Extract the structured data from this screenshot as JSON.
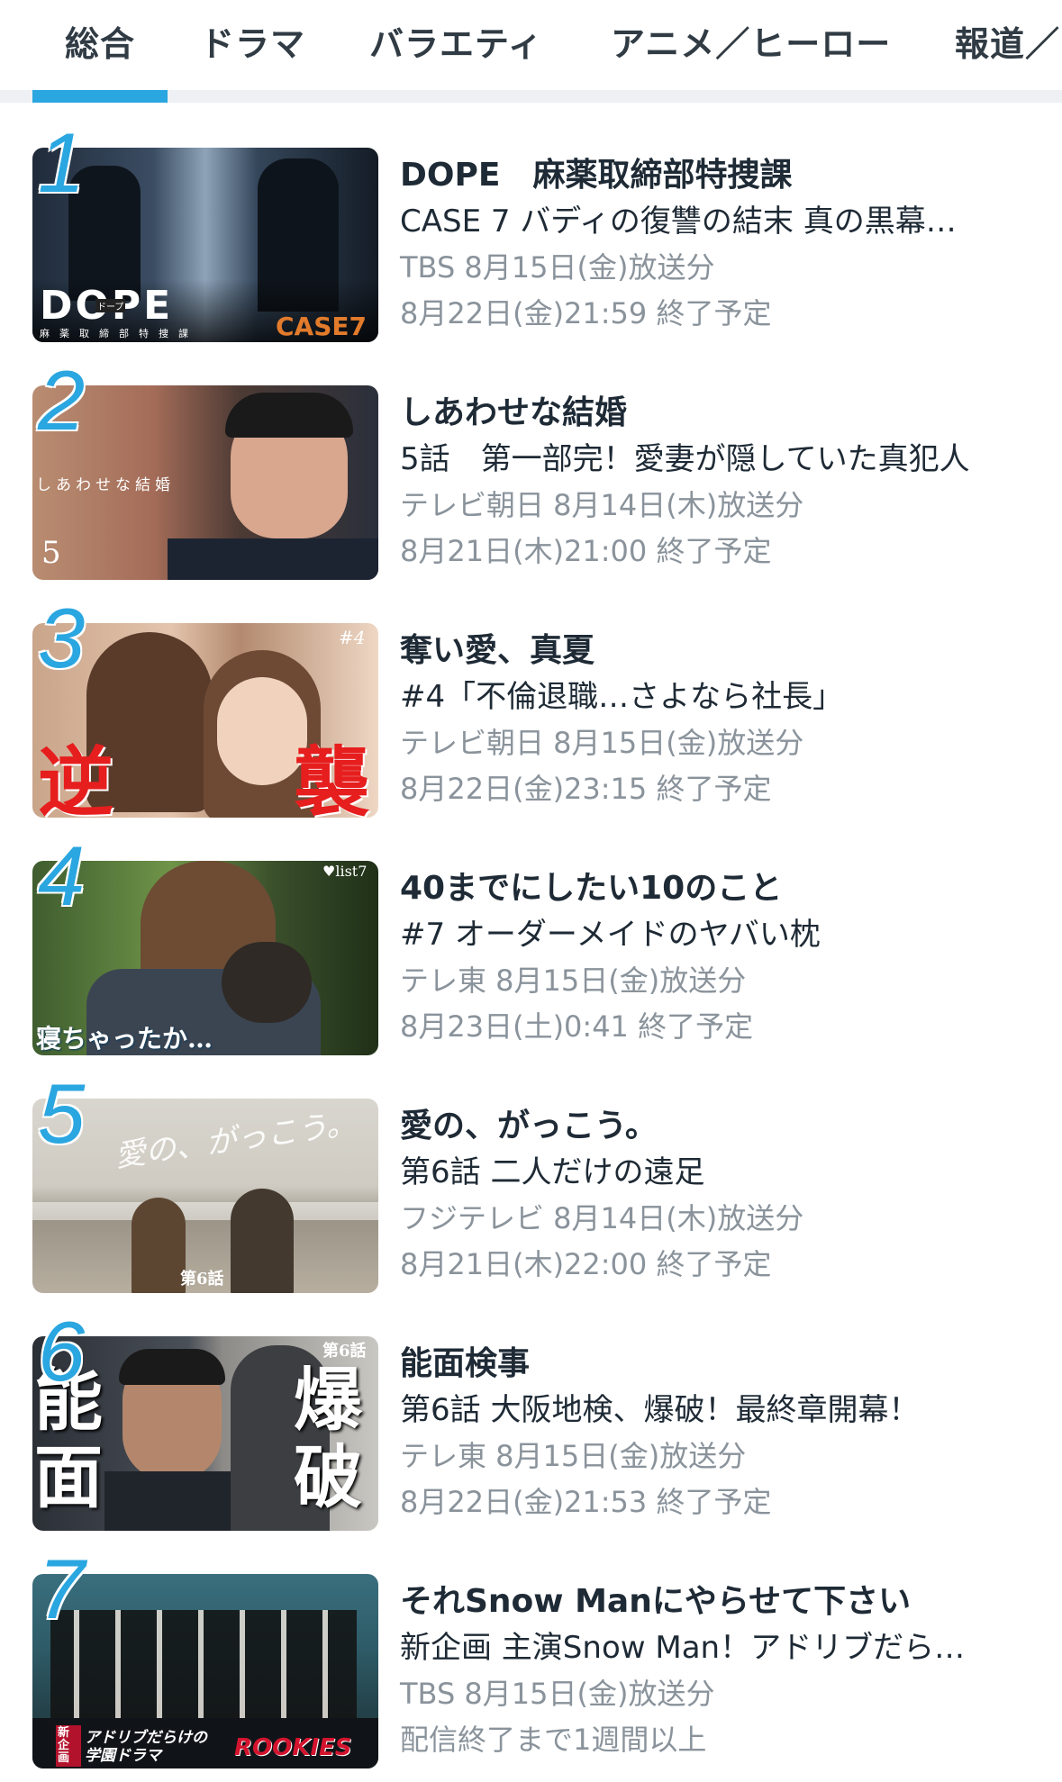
{
  "tabs": [
    {
      "label": "総合",
      "selected": true
    },
    {
      "label": "ドラマ",
      "selected": false
    },
    {
      "label": "バラエティ",
      "selected": false
    },
    {
      "label": "アニメ／ヒーロー",
      "selected": false
    },
    {
      "label": "報道／",
      "selected": false
    }
  ],
  "colors": {
    "accent": "#2aa6e0",
    "meta_text": "#8a939b"
  },
  "items": [
    {
      "rank": "1",
      "title": "DOPE　麻薬取締部特捜課",
      "subtitle": "CASE 7 バディの復讐の結末 真の黒幕…",
      "broadcast": "TBS 8月15日(金)放送分",
      "end": "8月22日(金)21:59 終了予定",
      "thumb_text": {
        "logo": "DOPE",
        "sub": "麻　薬　取　締　部　特　捜　課",
        "badge": "CASE7",
        "kana": "ドープ"
      }
    },
    {
      "rank": "2",
      "title": "しあわせな結婚",
      "subtitle": "5話　第一部完！愛妻が隠していた真犯人",
      "broadcast": "テレビ朝日 8月14日(木)放送分",
      "end": "8月21日(木)21:00 終了予定",
      "thumb_text": {
        "logo": "しあわせな結婚",
        "badge": "5"
      }
    },
    {
      "rank": "3",
      "title": "奪い愛、真夏",
      "subtitle": "#4「不倫退職…さよなら社長」",
      "broadcast": "テレビ朝日 8月15日(金)放送分",
      "end": "8月22日(金)23:15 終了予定",
      "thumb_text": {
        "left": "逆",
        "right": "襲",
        "badge": "#4"
      }
    },
    {
      "rank": "4",
      "title": "40までにしたい10のこと",
      "subtitle": "#7 オーダーメイドのヤバい枕",
      "broadcast": "テレ東 8月15日(金)放送分",
      "end": "8月23日(土)0:41 終了予定",
      "thumb_text": {
        "caption": "寝ちゃったか…",
        "badge": "♥list7"
      }
    },
    {
      "rank": "5",
      "title": "愛の、がっこう。",
      "subtitle": "第6話 二人だけの遠足",
      "broadcast": "フジテレビ 8月14日(木)放送分",
      "end": "8月21日(木)22:00 終了予定",
      "thumb_text": {
        "logo": "愛の、がっこう。",
        "badge": "第6話"
      }
    },
    {
      "rank": "6",
      "title": "能面検事",
      "subtitle": "第6話 大阪地検、爆破！最終章開幕！",
      "broadcast": "テレ東 8月15日(金)放送分",
      "end": "8月22日(金)21:53 終了予定",
      "thumb_text": {
        "left": "能面",
        "right": "爆破",
        "badge": "第6話"
      }
    },
    {
      "rank": "7",
      "title": "それSnow Manにやらせて下さい",
      "subtitle": "新企画 主演Snow Man！アドリブだら…",
      "broadcast": "TBS 8月15日(金)放送分",
      "end": "配信終了まで1週間以上",
      "thumb_text": {
        "new": "新企画",
        "caption": "アドリブだらけの学園ドラマ",
        "logo": "ROOKIES"
      }
    }
  ]
}
